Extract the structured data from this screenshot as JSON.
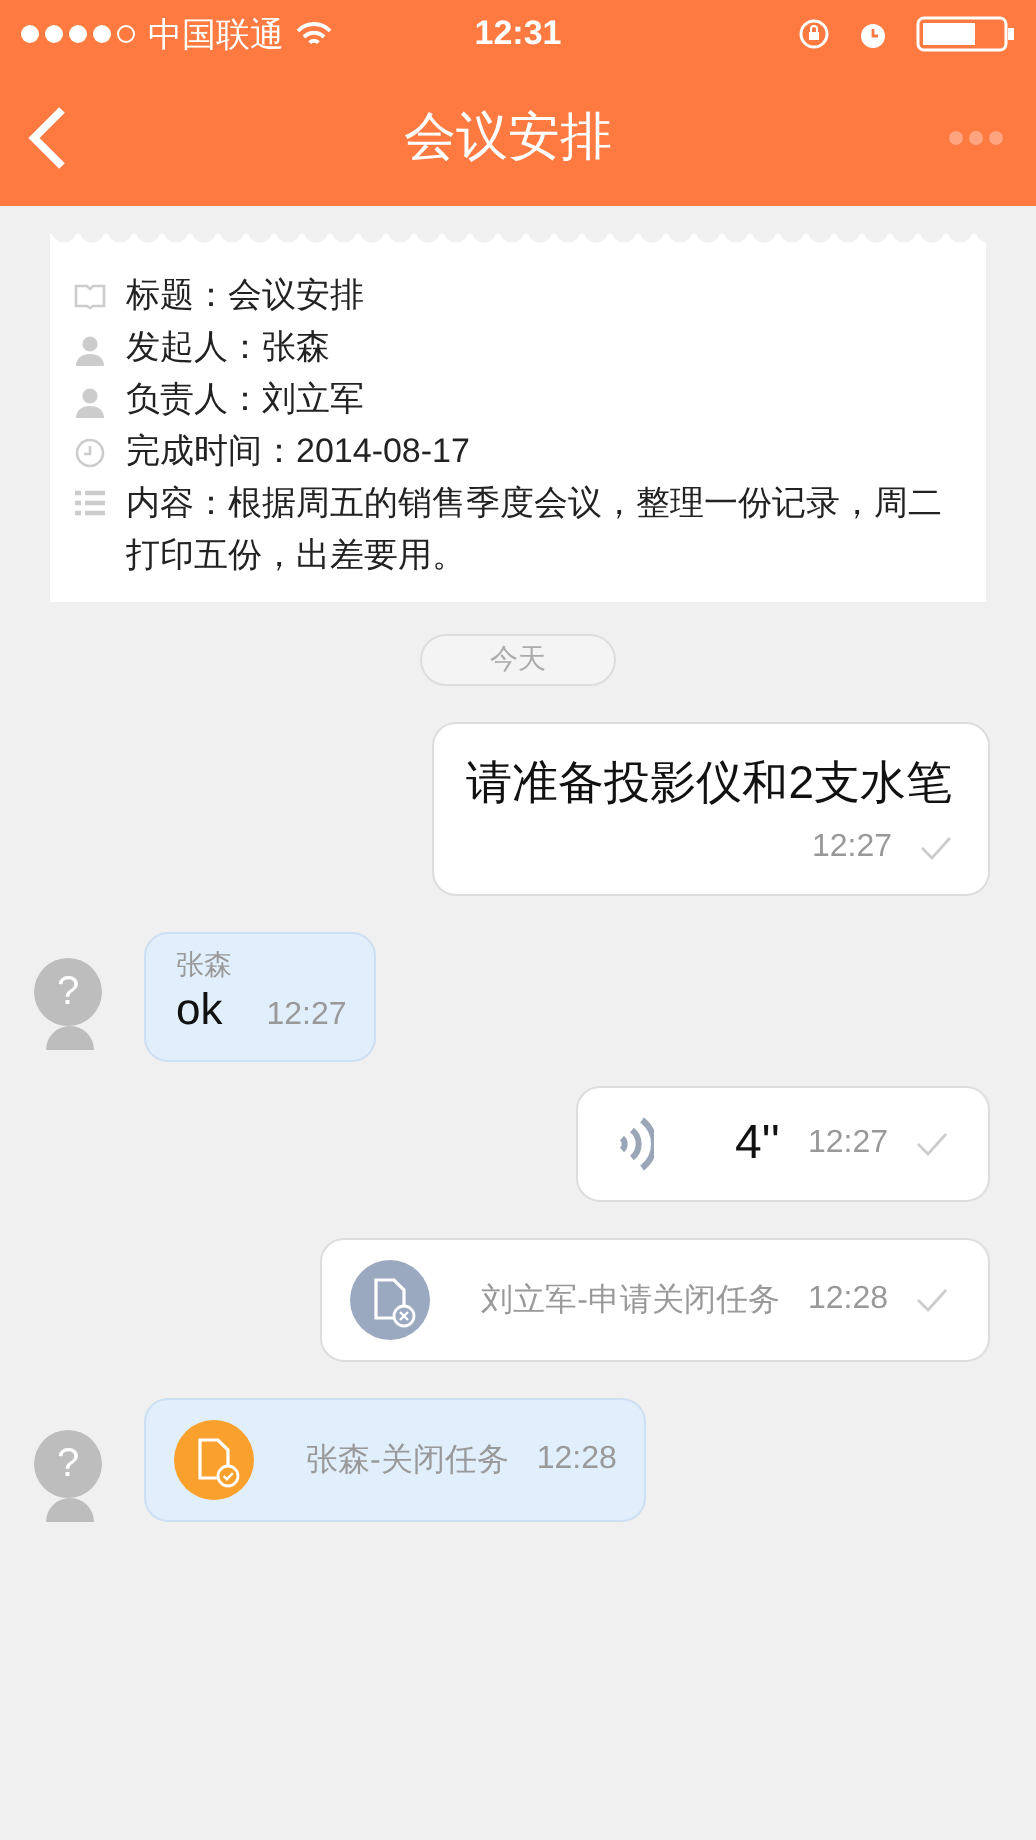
{
  "status_bar": {
    "carrier": "中国联通",
    "time": "12:31"
  },
  "nav": {
    "title": "会议安排"
  },
  "task_card": {
    "rows": [
      {
        "kind": "title",
        "label": "标题：",
        "value": "会议安排"
      },
      {
        "kind": "person",
        "label": "发起人：",
        "value": "张森"
      },
      {
        "kind": "person",
        "label": "负责人：",
        "value": "刘立军"
      },
      {
        "kind": "time",
        "label": "完成时间：",
        "value": "2014-08-17"
      },
      {
        "kind": "content",
        "label": "内容：",
        "value": "根据周五的销售季度会议，整理一份记录，周二打印五份，出差要用。"
      }
    ]
  },
  "date_divider": "今天",
  "messages": [
    {
      "kind": "text",
      "outgoing": true,
      "text": "请准备投影仪和2支水笔",
      "time": "12:27",
      "delivered": true
    },
    {
      "kind": "text",
      "outgoing": false,
      "avatar_mark": "?",
      "sender": "张森",
      "text": "ok",
      "time": "12:27",
      "delivered": false
    },
    {
      "kind": "voice",
      "outgoing": true,
      "duration": "4''",
      "time": "12:27",
      "delivered": true
    },
    {
      "kind": "task_request",
      "outgoing": true,
      "text": "刘立军-申请关闭任务",
      "time": "12:28",
      "delivered": true
    },
    {
      "kind": "task_closed",
      "outgoing": false,
      "avatar_mark": "?",
      "text": "张森-关闭任务",
      "time": "12:28",
      "delivered": false
    }
  ]
}
